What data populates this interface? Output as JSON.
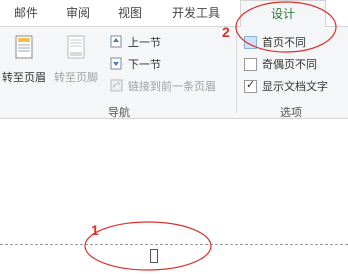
{
  "tabs": [
    {
      "label": "邮件"
    },
    {
      "label": "审阅"
    },
    {
      "label": "视图"
    },
    {
      "label": "开发工具"
    },
    {
      "label": "设计"
    }
  ],
  "active_tab": "设计",
  "nav_group": {
    "label": "导航",
    "goto_header": "转至页眉",
    "goto_footer": "转至页脚",
    "prev_section": "上一节",
    "next_section": "下一节",
    "link_previous": "链接到前一条页眉"
  },
  "options_group": {
    "label": "选项",
    "first_page_diff": "首页不同",
    "first_page_diff_checked": false,
    "odd_even_diff": "奇偶页不同",
    "odd_even_diff_checked": false,
    "show_doc_text": "显示文档文字",
    "show_doc_text_checked": true
  },
  "annotations": [
    {
      "number": "1"
    },
    {
      "number": "2"
    }
  ],
  "colors": {
    "accent_green": "#2b7a36",
    "annotation_red": "#d9312b"
  }
}
